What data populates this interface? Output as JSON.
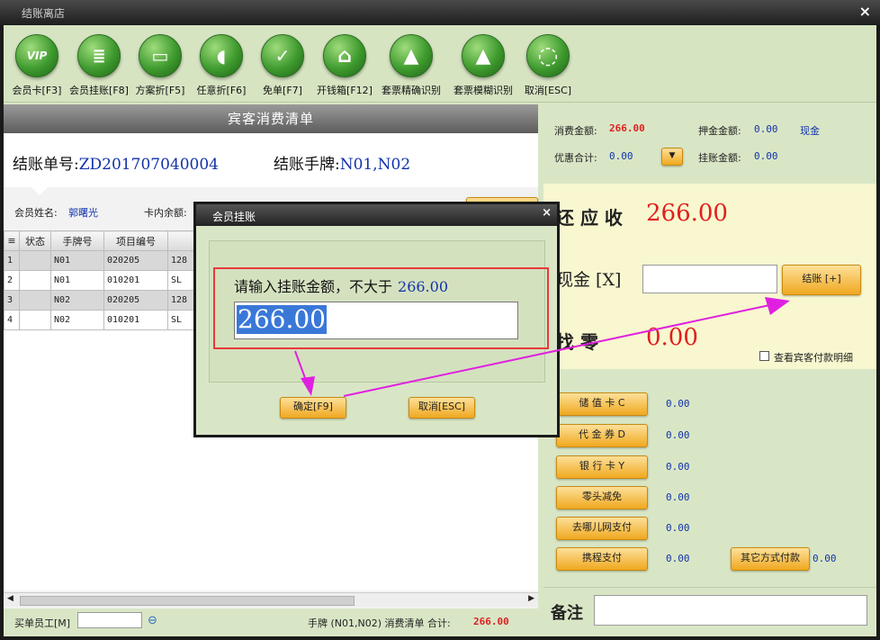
{
  "window": {
    "title": "结账离店",
    "close_glyph": "×"
  },
  "toolbar": {
    "buttons": [
      {
        "label": "会员卡[F3]",
        "icon": "vip-icon",
        "glyph": "VIP"
      },
      {
        "label": "会员挂账[F8]",
        "icon": "member-credit-icon",
        "glyph": "≣"
      },
      {
        "label": "方案折[F5]",
        "icon": "discount-plan-icon",
        "glyph": "▭"
      },
      {
        "label": "任意折[F6]",
        "icon": "free-discount-icon",
        "glyph": "◖"
      },
      {
        "label": "免单[F7]",
        "icon": "free-bill-icon",
        "glyph": "✓"
      },
      {
        "label": "开钱箱[F12]",
        "icon": "cash-drawer-icon",
        "glyph": "⌂"
      },
      {
        "label": "套票精确识别",
        "icon": "ticket-exact-icon",
        "glyph": "▲"
      },
      {
        "label": "套票模糊识别",
        "icon": "ticket-fuzzy-icon",
        "glyph": "▲"
      },
      {
        "label": "取消[ESC]",
        "icon": "cancel-icon",
        "glyph": "◌"
      }
    ]
  },
  "left": {
    "title": "宾客消费清单",
    "order_label": "结账单号:",
    "order_no": "ZD201707040004",
    "tag_label": "结账手牌:",
    "tag_no": "N01,N02",
    "member_name_label": "会员姓名:",
    "member_name": "郭曙光",
    "card_balance_label": "卡内余额:",
    "table": {
      "headers": [
        "状态",
        "手牌号",
        "项目编号",
        ""
      ],
      "rows": [
        {
          "idx": "1",
          "status": "",
          "tag": "N01",
          "code": "020205",
          "name": "128"
        },
        {
          "idx": "2",
          "status": "",
          "tag": "N01",
          "code": "010201",
          "name": "SL"
        },
        {
          "idx": "3",
          "status": "",
          "tag": "N02",
          "code": "020205",
          "name": "128"
        },
        {
          "idx": "4",
          "status": "",
          "tag": "N02",
          "code": "010201",
          "name": "SL"
        }
      ]
    },
    "bottom": {
      "staff_label": "买单员工[M]",
      "staff_value": "",
      "summary": "手牌 (N01,N02) 消费清单 合计:",
      "total": "266.00"
    }
  },
  "right": {
    "consume_label": "消费金额:",
    "consume_value": "266.00",
    "deposit_label": "押金金额:",
    "deposit_value": "0.00",
    "cash_label": "现金",
    "discount_label": "优惠合计:",
    "discount_value": "0.00",
    "credit_label": "挂账金额:",
    "credit_value": "0.00",
    "due_label": "还 应 收",
    "due_value": "266.00",
    "cash_input_label": "现金 [X]",
    "cash_input_value": "",
    "checkout_label": "结账 [+]",
    "change_label": "找    零",
    "change_value": "0.00",
    "detail_checkbox_label": "查看宾客付款明细",
    "payments": [
      {
        "label": "储 值 卡 C",
        "value": "0.00"
      },
      {
        "label": "代 金 券 D",
        "value": "0.00"
      },
      {
        "label": "银 行 卡 Y",
        "value": "0.00"
      },
      {
        "label": "零头减免",
        "value": "0.00"
      },
      {
        "label": "去哪儿网支付",
        "value": "0.00"
      },
      {
        "label": "携程支付",
        "value": "0.00"
      }
    ],
    "other_pay_label": "其它方式付款",
    "other_pay_value": "0.00",
    "note_label": "备注",
    "note_value": ""
  },
  "dialog": {
    "title": "会员挂账",
    "close_glyph": "×",
    "prompt": "请输入挂账金额，不大于",
    "max_amount": "266.00",
    "input_value": "266.00",
    "confirm_label": "确定[F9]",
    "cancel_label": "取消[ESC]"
  },
  "colors": {
    "panel_green": "#d9e6c6",
    "due_yellow": "#f8f7cf",
    "accent_red": "#e02020",
    "value_blue": "#1233a8",
    "button_orange": "#f0a820",
    "annotation_magenta": "#e020e0",
    "highlight_box": "#e83a3a"
  }
}
